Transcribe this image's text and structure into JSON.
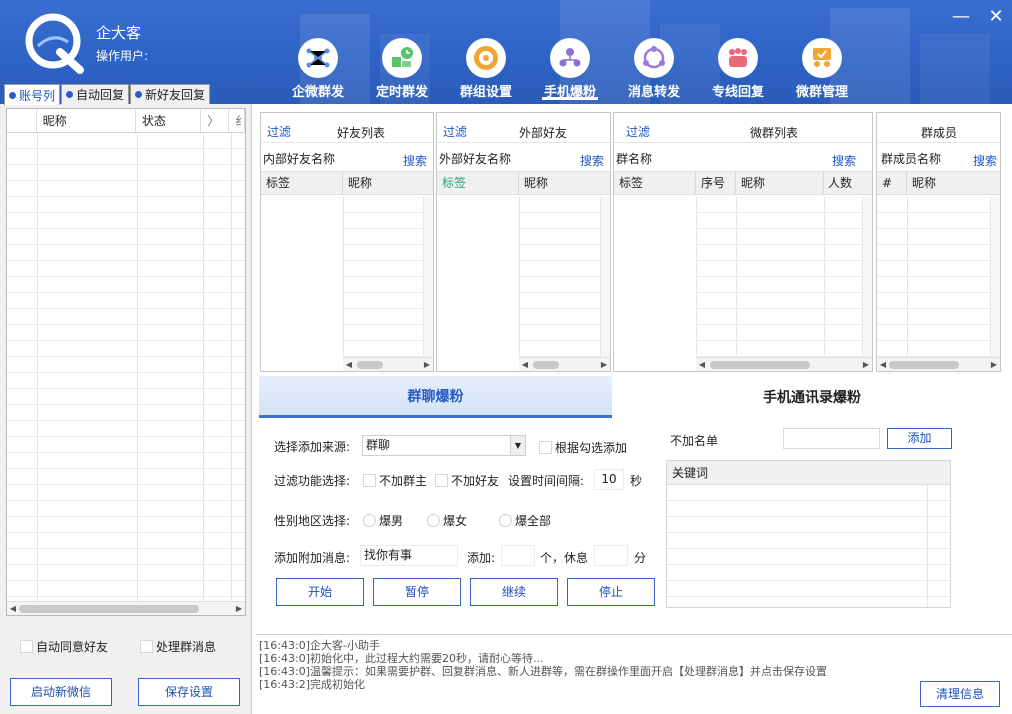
{
  "app": {
    "title": "企大客",
    "operator_label": "操作用户:"
  },
  "window": {
    "minimize": "—",
    "close": "✕"
  },
  "nav": [
    {
      "label": "企微群发",
      "icon": "network-icon",
      "color": "#5a8fe0"
    },
    {
      "label": "定时群发",
      "icon": "scheduled-send-icon",
      "color": "#5cc16a"
    },
    {
      "label": "群组设置",
      "icon": "group-settings-icon",
      "color": "#f0a637"
    },
    {
      "label": "手机爆粉",
      "icon": "phone-fans-icon",
      "color": "#8f6fd6",
      "active": true
    },
    {
      "label": "消息转发",
      "icon": "forward-icon",
      "color": "#9b7ae0"
    },
    {
      "label": "专线回复",
      "icon": "reply-icon",
      "color": "#e86a7a"
    },
    {
      "label": "微群管理",
      "icon": "group-manage-icon",
      "color": "#f0a637"
    }
  ],
  "left": {
    "tabs": [
      "账号列",
      "自动回复",
      "新好友回复"
    ],
    "columns": [
      "昵称",
      "状态",
      "〉",
      "纟"
    ],
    "auto_accept": "自动同意好友",
    "handle_group": "处理群消息",
    "start_button": "启动新微信",
    "save_button": "保存设置"
  },
  "panels": {
    "friends": {
      "filter": "过滤",
      "title": "好友列表",
      "search_label": "内部好友名称",
      "search": "搜索",
      "cols": [
        "标签",
        "昵称"
      ]
    },
    "external": {
      "filter": "过滤",
      "title": "外部好友",
      "search_label": "外部好友名称",
      "search": "搜索",
      "cols": [
        "标签",
        "昵称"
      ]
    },
    "groups": {
      "filter": "过滤",
      "title": "微群列表",
      "search_label": "群名称",
      "search": "搜索",
      "cols": [
        "标签",
        "序号",
        "昵称",
        "人数"
      ]
    },
    "members": {
      "title": "群成员",
      "search_label": "群成员名称",
      "search": "搜索",
      "cols": [
        "#",
        "昵称"
      ]
    }
  },
  "bottom_tabs": {
    "active": "群聊爆粉",
    "other": "手机通讯录爆粉"
  },
  "form": {
    "source_label": "选择添加来源:",
    "source_value": "群聊",
    "by_check": "根据勾选添加",
    "filter_label": "过滤功能选择:",
    "no_owner": "不加群主",
    "no_friend": "不加好友",
    "interval_label": "设置时间间隔:",
    "interval_value": "10",
    "interval_unit": "秒",
    "gender_label": "性别地区选择:",
    "male": "爆男",
    "female": "爆女",
    "all": "爆全部",
    "msg_label": "添加附加消息:",
    "msg_value": "找你有事",
    "add_label": "添加:",
    "add_unit": "个，休息",
    "rest_unit": "分",
    "blacklist_label": "不加名单",
    "add_button": "添加",
    "keyword_header": "关键词",
    "start": "开始",
    "pause": "暂停",
    "resume": "继续",
    "stop": "停止"
  },
  "log": {
    "lines": [
      "[16:43:0]企大客-小助手",
      "[16:43:0]初始化中，此过程大约需要20秒，请耐心等待...",
      "[16:43:0]温馨提示：如果需要护群、回复群消息、新人进群等，需在群操作里面开启【处理群消息】并点击保存设置",
      "[16:43:2]完成初始化"
    ],
    "clear_button": "清理信息"
  }
}
